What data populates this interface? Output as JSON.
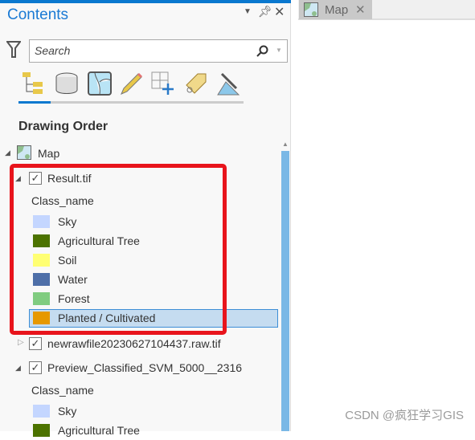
{
  "pane": {
    "title": "Contents",
    "search_placeholder": "Search",
    "section": "Drawing Order",
    "header_buttons": [
      "menu-dropdown",
      "pin",
      "close"
    ],
    "tools": [
      "list-by-drawing-order",
      "list-by-source",
      "list-by-selection",
      "list-by-editing",
      "list-by-snapping",
      "list-by-labeling",
      "list-by-perspective-imagery"
    ]
  },
  "tree": {
    "map": "Map",
    "layers": [
      {
        "name": "Result.tif",
        "checked": true,
        "expanded": true,
        "field": "Class_name",
        "classes": [
          {
            "label": "Sky",
            "color": "#c4d6ff"
          },
          {
            "label": "Agricultural Tree",
            "color": "#4c7300"
          },
          {
            "label": "Soil",
            "color": "#ffff73"
          },
          {
            "label": "Water",
            "color": "#4e6fa8"
          },
          {
            "label": "Forest",
            "color": "#80cc80"
          },
          {
            "label": "Planted / Cultivated",
            "color": "#e69800",
            "selected": true
          }
        ]
      },
      {
        "name": "newrawfile20230627104437.raw.tif",
        "checked": true,
        "expanded": false
      },
      {
        "name": "Preview_Classified_SVM_5000__2316",
        "checked": true,
        "expanded": true,
        "field": "Class_name",
        "classes": [
          {
            "label": "Sky",
            "color": "#c4d6ff"
          },
          {
            "label": "Agricultural Tree",
            "color": "#4c7300"
          }
        ]
      }
    ]
  },
  "map_tab": {
    "label": "Map"
  },
  "watermark": "CSDN @疯狂学习GIS",
  "colors": {
    "accent": "#0a78cf",
    "highlight": "#e8141c"
  }
}
